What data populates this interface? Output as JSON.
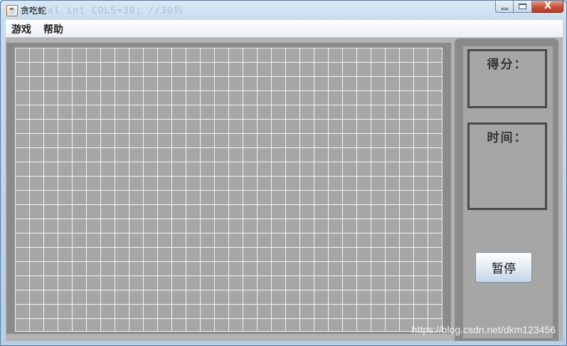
{
  "window": {
    "title": "贪吃蛇",
    "ghost_text": "al int COLS=30; //30列",
    "icon": "java-cup-icon",
    "controls": {
      "minimize": "minimize-icon",
      "maximize": "maximize-icon",
      "close_glyph": "X"
    }
  },
  "menubar": {
    "items": [
      {
        "label": "游戏"
      },
      {
        "label": "帮助"
      }
    ]
  },
  "board": {
    "columns": 30,
    "rows": 20,
    "background_color": "#a6a6a6",
    "grid_line_color": "#f2f2f2"
  },
  "sidebar": {
    "score_label": "得分：",
    "time_label": "时间：",
    "pause_label": "暂停"
  },
  "watermark": "https://blog.csdn.net/dkm123456",
  "colors": {
    "panel_border": "#8a8a8a",
    "box_border": "#4a4a4a"
  }
}
